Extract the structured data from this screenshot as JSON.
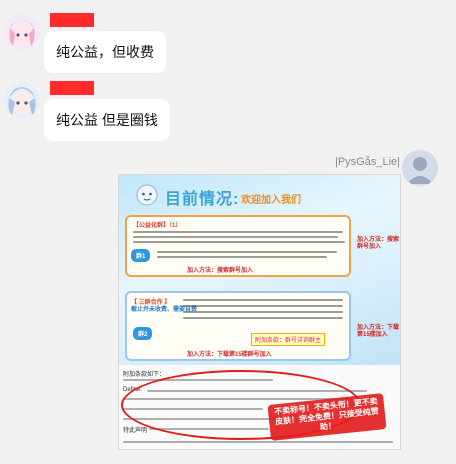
{
  "messages": [
    {
      "text": "纯公益，但收费"
    },
    {
      "text": "纯公益 但是圈钱"
    }
  ],
  "shared_image": {
    "sender_name": "|PysGås_Lie|",
    "poster": {
      "heading": "目前情况:",
      "slogan": "欢迎加入我们",
      "box_a_title": "【公益化群】（1）",
      "box_a_pill": "群1",
      "box_a_join": "加入方法：搜索群号加入",
      "box_a_side": "加入方法：搜索群号加入",
      "box_b_title": "【 三群合作 】",
      "box_b_subtitle": "截止并未收费、需要自费",
      "box_b_pill": "群2",
      "box_b_tag": "附加条款：群号详询群主",
      "box_b_join": "加入方法：下载第15楼群号加入",
      "box_b_side": "加入方法：下载第15楼加入"
    },
    "doc": {
      "line1": "附加条款如下：",
      "line2": "Define:",
      "line3": "特此声明",
      "stamp": "不卖称号！不卖头衔！更不卖皮肤！完全免费！只接受纯赞助！"
    }
  },
  "colors": {
    "name_bar": "#ff2b2b",
    "bubble": "#ffffff",
    "background": "#f1f1f1"
  }
}
